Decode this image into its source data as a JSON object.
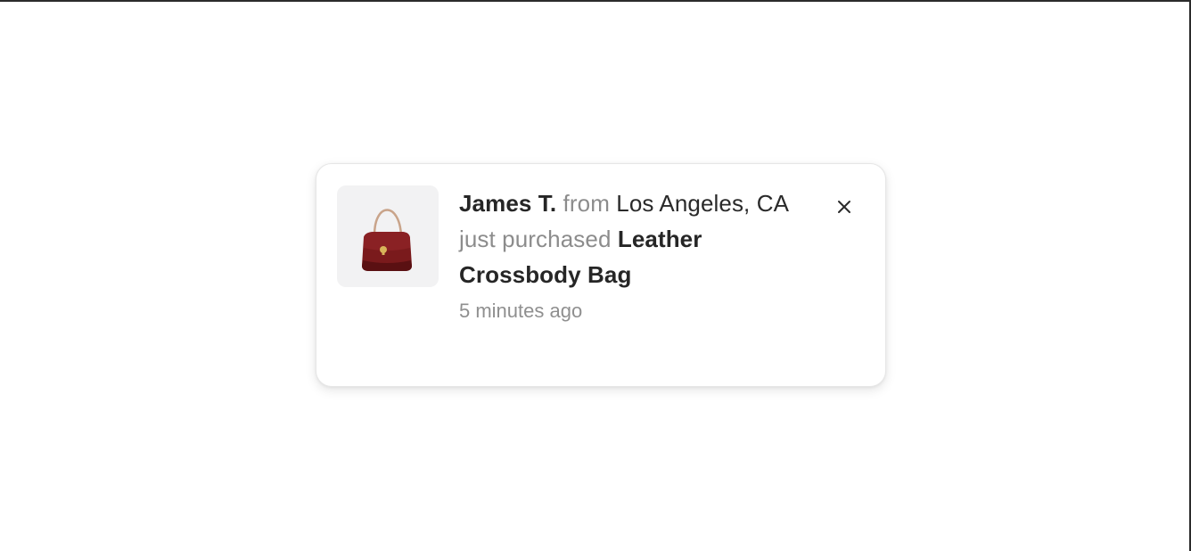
{
  "notification": {
    "customer_name": "James T.",
    "from_word": "from",
    "location": "Los Angeles, CA",
    "action_text": "just purchased",
    "product_name": "Leather Crossbody Bag",
    "time_ago": "5 minutes ago",
    "product_image_icon": "handbag-icon",
    "close_icon": "close-icon"
  },
  "colors": {
    "bag_primary": "#7a1a1c",
    "bag_dark": "#5a1012",
    "strap": "#c9a48a",
    "clasp": "#d8b45a",
    "thumb_bg": "#f2f2f3",
    "muted_text": "#8c8c8c",
    "strong_text": "#262626"
  }
}
